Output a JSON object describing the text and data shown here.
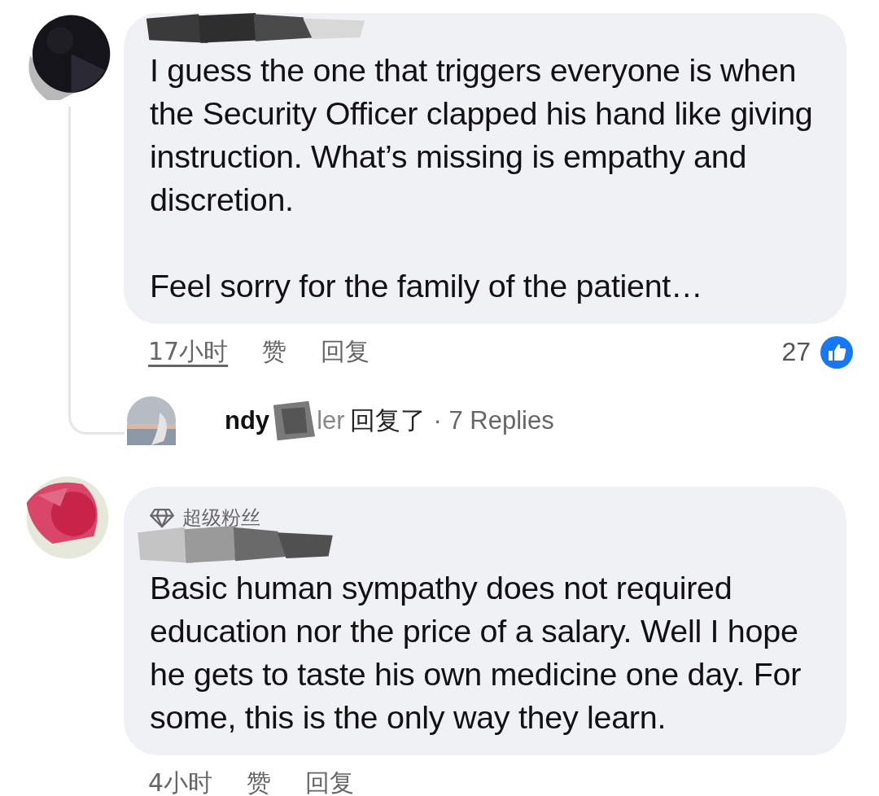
{
  "comments": [
    {
      "paragraphs": [
        "I guess the one that triggers everyone is when the Security Officer clapped his hand like giving instruction. What’s missing is empathy and discretion.",
        "Feel sorry for the family of the patient…"
      ],
      "time": "17小时",
      "like_label": "赞",
      "reply_label": "回复",
      "reaction_count": "27",
      "reply_summary": {
        "name_parts": [
          "ndy",
          "ler"
        ],
        "action": "回复了",
        "count": "· 7 Replies"
      }
    },
    {
      "badge": "超级粉丝",
      "paragraphs": [
        "Basic human sympathy does not required education nor the price of a salary. Well I hope he gets to taste his own medicine one day. For some, this is the only way they learn."
      ],
      "time": "4小时",
      "like_label": "赞",
      "reply_label": "回复"
    }
  ]
}
